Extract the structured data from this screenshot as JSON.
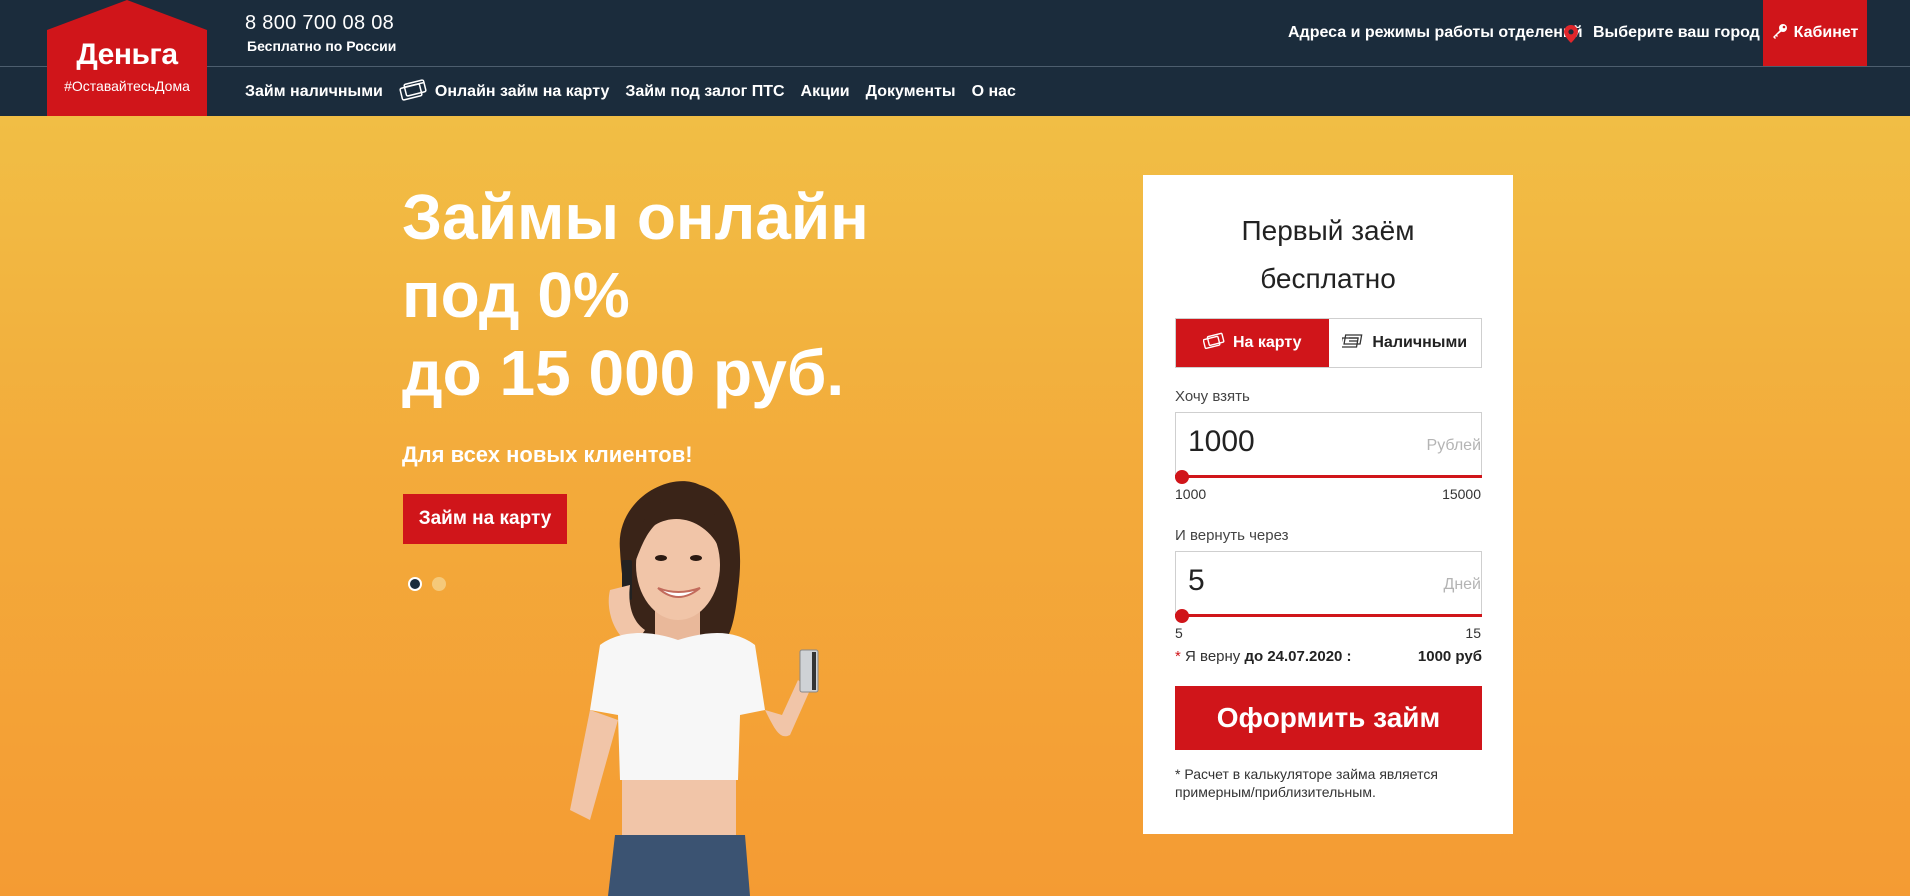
{
  "brand": {
    "name": "Деньга",
    "tagline": "#ОставайтесьДома",
    "accent": "#d0151a",
    "header_bg": "#1b2c3c"
  },
  "contact": {
    "phone": "8 800 700 08 08",
    "phone_note": "Бесплатно по России"
  },
  "topbar": {
    "branches_link": "Адреса и режимы работы отделений",
    "city_link": "Выберите ваш город",
    "cabinet_label": "Кабинет",
    "pin_icon": "location-pin-icon",
    "key_icon": "key-icon"
  },
  "nav": {
    "items": [
      {
        "label": "Займ наличными"
      },
      {
        "label": "Онлайн займ на карту",
        "icon": "card-icon"
      },
      {
        "label": "Займ под залог ПТС"
      },
      {
        "label": "Акции"
      },
      {
        "label": "Документы"
      },
      {
        "label": "О нас"
      }
    ]
  },
  "hero": {
    "title_lines": [
      "Займы онлайн",
      "под 0%",
      "до 15 000 руб."
    ],
    "subtitle": "Для всех новых клиентов!",
    "cta_label": "Займ на карту",
    "slides_total": 2,
    "slide_active": 1
  },
  "calculator": {
    "title_lines": [
      "Первый заём",
      "бесплатно"
    ],
    "tabs": [
      {
        "label": "На карту",
        "icon": "card-icon",
        "active": true
      },
      {
        "label": "Наличными",
        "icon": "cash-icon",
        "active": false
      }
    ],
    "amount": {
      "label": "Хочу взять",
      "value": "1000",
      "unit": "Рублей",
      "min": "1000",
      "max": "15000",
      "slider_fraction": 0
    },
    "term": {
      "label": "И вернуть через",
      "value": "5",
      "unit": "Дней",
      "min": "5",
      "max": "15",
      "slider_fraction": 0
    },
    "summary": {
      "asterisk": "*",
      "prefix": "Я верну",
      "date_text": "до 24.07.2020 :",
      "amount": "1000 руб"
    },
    "submit_label": "Оформить займ",
    "note": "* Расчет в калькуляторе займа является примерным/приблизительным."
  }
}
